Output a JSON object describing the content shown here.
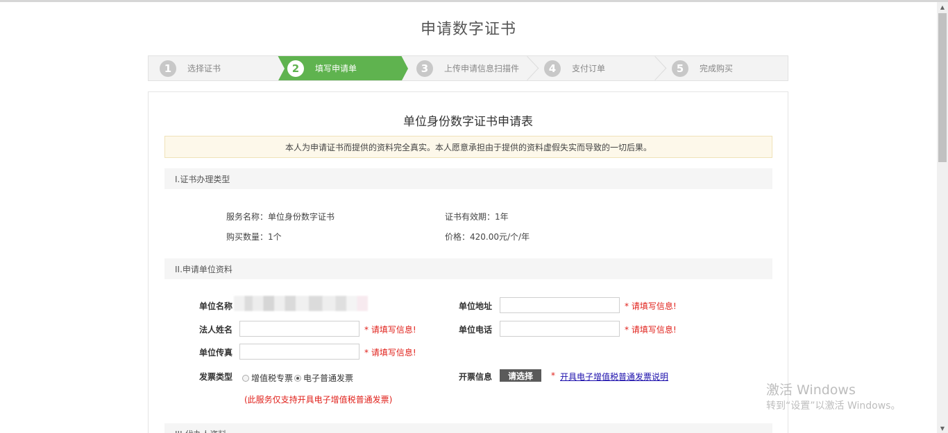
{
  "page": {
    "title": "申请数字证书"
  },
  "steps": [
    {
      "num": "1",
      "label": "选择证书",
      "active": false
    },
    {
      "num": "2",
      "label": "填写申请单",
      "active": true
    },
    {
      "num": "3",
      "label": "上传申请信息扫描件",
      "active": false
    },
    {
      "num": "4",
      "label": "支付订单",
      "active": false
    },
    {
      "num": "5",
      "label": "完成购买",
      "active": false
    }
  ],
  "form": {
    "title": "单位身份数字证书申请表",
    "notice": "本人为申请证书而提供的资料完全真实。本人愿意承担由于提供的资料虚假失实而导致的一切后果。",
    "section1": {
      "header": "I.证书办理类型",
      "service_name": "服务名称：单位身份数字证书",
      "validity": "证书有效期：1年",
      "quantity": "购买数量：1个",
      "price": "价格：420.00元/个/年"
    },
    "section2": {
      "header": "II.申请单位资料",
      "org_name_label": "单位名称",
      "org_address_label": "单位地址",
      "legal_name_label": "法人姓名",
      "org_phone_label": "单位电话",
      "org_fax_label": "单位传真",
      "invoice_type_label": "发票类型",
      "invoice_options": [
        "增值税专票",
        "电子普通发票"
      ],
      "invoice_selected": "电子普通发票",
      "invoice_info_label": "开票信息",
      "choose_button": "请选择",
      "asterisk": "*",
      "invoice_link": "开具电子增值税普通发票说明",
      "invoice_note": "(此服务仅支持开具电子增值税普通发票)",
      "required_msg": "* 请填写信息!"
    },
    "section3": {
      "header": "III.代办人资料"
    }
  },
  "watermark": {
    "line1": "激活 Windows",
    "line2": "转到“设置”以激活 Windows。"
  },
  "colors": {
    "active_step": "#5fb34f",
    "required": "#e0211b",
    "link": "#1a0dab"
  }
}
